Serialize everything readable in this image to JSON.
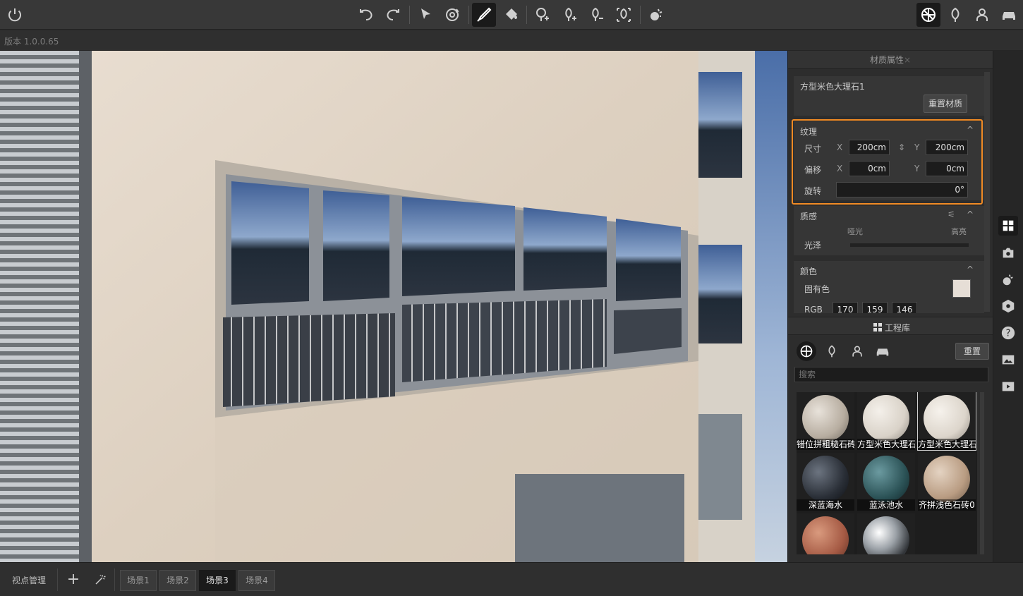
{
  "app": {
    "version_label": "版本 1.0.0.65"
  },
  "toolbar": {
    "icons": [
      "power-icon",
      "undo-icon",
      "redo-icon",
      "select-icon",
      "orbit-icon",
      "eyedropper-icon",
      "paint-bucket-icon",
      "add-tree-icon",
      "add-plant-icon",
      "remove-plant-icon",
      "scatter-plant-icon",
      "weather-icon",
      "material-icon",
      "plant-library-icon",
      "people-library-icon",
      "vehicle-library-icon"
    ]
  },
  "material_panel": {
    "title": "材质属性",
    "close_glyph": "×",
    "material_name": "方型米色大理石1",
    "reset_material_label": "重置材质",
    "texture": {
      "section_title": "纹理",
      "size_label": "尺寸",
      "offset_label": "偏移",
      "rotation_label": "旋转",
      "x_label": "X",
      "y_label": "Y",
      "size_x": "200cm",
      "size_y": "200cm",
      "offset_x": "0cm",
      "offset_y": "0cm",
      "rotation": "0°"
    },
    "quality": {
      "section_title": "质感",
      "gloss_label": "光泽",
      "matte_label": "哑光",
      "glossy_label": "高亮"
    },
    "color": {
      "section_title": "颜色",
      "base_color_label": "固有色",
      "rgb_label": "RGB",
      "r": "170",
      "g": "159",
      "b": "146",
      "swatch_hex": "#e6ded6"
    }
  },
  "library_panel": {
    "title": "工程库",
    "reset_label": "重置",
    "search_placeholder": "搜索",
    "materials": [
      {
        "name": "错位拼粗糙石砖",
        "selected": false
      },
      {
        "name": "方型米色大理石",
        "selected": false
      },
      {
        "name": "方型米色大理石",
        "selected": true
      },
      {
        "name": "深蓝海水",
        "selected": false
      },
      {
        "name": "蓝泳池水",
        "selected": false
      },
      {
        "name": "齐拼浅色石砖0",
        "selected": false
      },
      {
        "name": "",
        "selected": false
      },
      {
        "name": "",
        "selected": false
      }
    ]
  },
  "right_rail": {
    "icons": [
      "grid-icon",
      "camera-icon",
      "weather-icon",
      "settings-icon",
      "help-icon",
      "image-icon",
      "video-icon"
    ]
  },
  "bottom_bar": {
    "viewpoint_label": "视点管理",
    "scenes": [
      {
        "label": "场景1",
        "active": false
      },
      {
        "label": "场景2",
        "active": false
      },
      {
        "label": "场景3",
        "active": true
      },
      {
        "label": "场景4",
        "active": false
      }
    ]
  },
  "colors": {
    "accent_highlight": "#f08a24",
    "panel_bg": "#2d2d2d"
  }
}
